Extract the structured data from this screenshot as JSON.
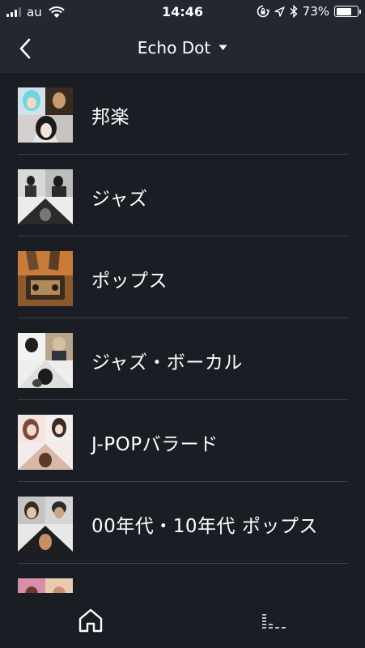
{
  "status_bar": {
    "carrier": "au",
    "time": "14:46",
    "battery_percent": "73%",
    "battery_level": 0.73,
    "icons": [
      "signal-icon",
      "wifi-icon",
      "rotation-lock-icon",
      "location-icon",
      "bluetooth-icon",
      "battery-icon"
    ]
  },
  "nav": {
    "back_icon": "back-chevron-icon",
    "title": "Echo Dot",
    "dropdown_icon": "caret-down-icon"
  },
  "stations": [
    {
      "label": "邦楽",
      "art": "jpop-collage"
    },
    {
      "label": "ジャズ",
      "art": "jazz-collage"
    },
    {
      "label": "ポップス",
      "art": "pops-collage"
    },
    {
      "label": "ジャズ・ボーカル",
      "art": "jazz-vocal-collage"
    },
    {
      "label": "J-POPバラード",
      "art": "jpop-ballad-collage"
    },
    {
      "label": "00年代・10年代 ポップス",
      "art": "pops-2000s-collage"
    },
    {
      "label": "",
      "art": "partial-collage"
    }
  ],
  "tabs": [
    {
      "icon": "home-icon",
      "active": true
    },
    {
      "icon": "now-playing-icon",
      "active": false
    }
  ],
  "colors": {
    "background": "#1a1e24",
    "header": "#232830",
    "divider": "#3d424a",
    "text": "#ffffff"
  }
}
